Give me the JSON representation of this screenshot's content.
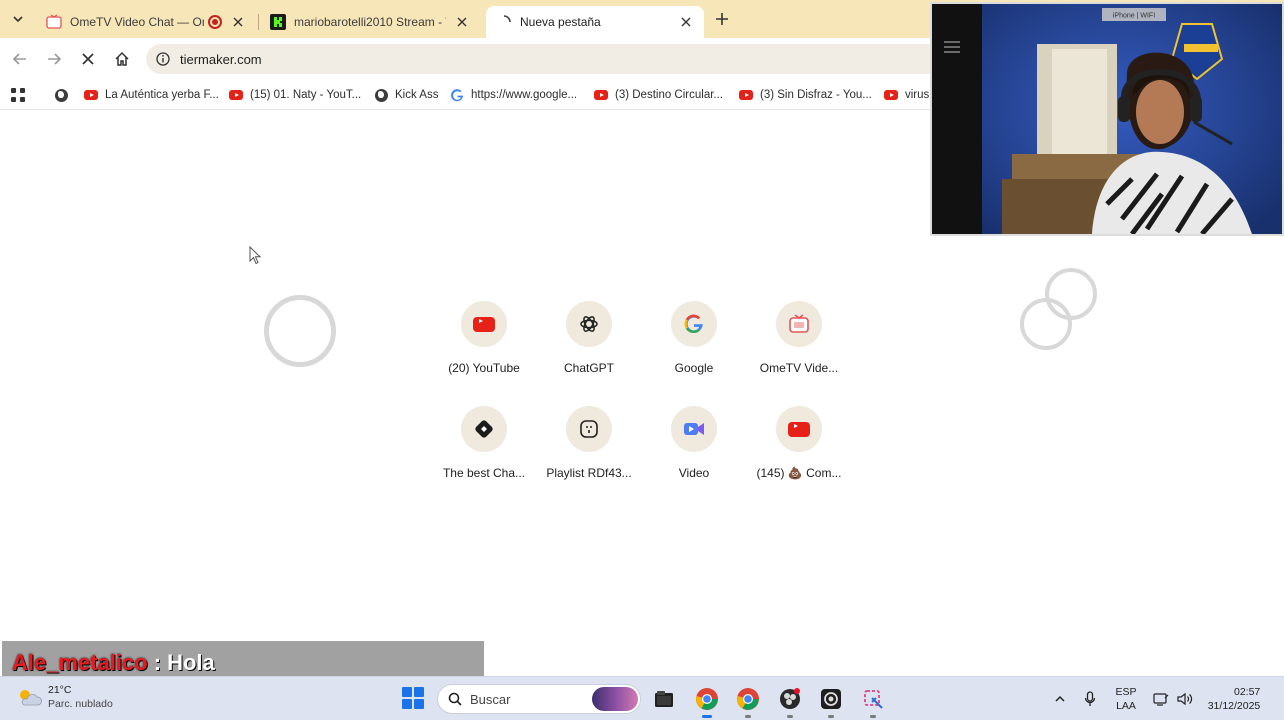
{
  "browser": {
    "tabs": [
      {
        "title": "OmeTV Video Chat — Ome",
        "active": false,
        "recording": true
      },
      {
        "title": "mariobarotelli2010 Stream - W",
        "active": false
      },
      {
        "title": "Nueva pestaña",
        "active": true
      }
    ],
    "address": "tiermaker.com",
    "bookmarks": [
      {
        "label": "La Auténtica yerba F...",
        "icon": "youtube-icon"
      },
      {
        "label": "(15) 01. Naty - YouT...",
        "icon": "youtube-icon"
      },
      {
        "label": "Kick Ass",
        "icon": "globe-icon"
      },
      {
        "label": "https://www.google...",
        "icon": "google-icon"
      },
      {
        "label": "(3) Destino Circular...",
        "icon": "youtube-icon"
      },
      {
        "label": "(3) Sin Disfraz - You...",
        "icon": "youtube-icon"
      },
      {
        "label": "virus",
        "icon": "youtube-icon"
      }
    ]
  },
  "shortcuts": [
    {
      "label": "(20) YouTube",
      "icon": "youtube-icon"
    },
    {
      "label": "ChatGPT",
      "icon": "chatgpt-icon"
    },
    {
      "label": "Google",
      "icon": "google-icon"
    },
    {
      "label": "OmeTV Vide...",
      "icon": "ometv-icon"
    },
    {
      "label": "The best Cha...",
      "icon": "chat-app-icon"
    },
    {
      "label": "Playlist RDf43...",
      "icon": "playlist-icon"
    },
    {
      "label": "Video",
      "icon": "video-icon"
    },
    {
      "label": "(145) 💩 Com...",
      "icon": "youtube-icon"
    }
  ],
  "webcam": {
    "sign_text": "iPhone | WIFI"
  },
  "chat": {
    "user": "Ale_metalico",
    "separator": ":",
    "message": "Hola"
  },
  "taskbar": {
    "weather_temp": "21°C",
    "weather_desc": "Parc. nublado",
    "search_placeholder": "Buscar",
    "lang_top": "ESP",
    "lang_bottom": "LAA",
    "time": "02:57",
    "date": "31/12/2025"
  },
  "colors": {
    "tabstrip": "#f7e6b8",
    "tile_bg": "#efe9de",
    "youtube_red": "#e62117",
    "chat_user": "#e8191f",
    "taskbar": "#dde3f0"
  }
}
